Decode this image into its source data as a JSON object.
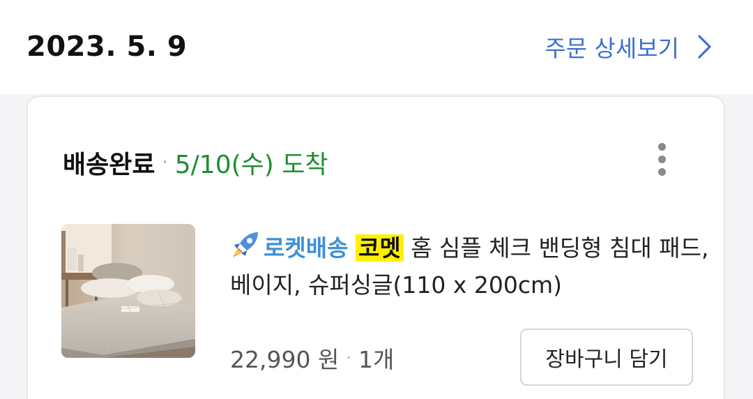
{
  "order": {
    "date": "2023. 5. 9",
    "detail_link_label": "주문 상세보기"
  },
  "shipment": {
    "status": "배송완료",
    "separator": "·",
    "arrival": "5/10(수) 도착"
  },
  "product": {
    "delivery_badge": "로켓배송",
    "brand": "코멧",
    "name_rest": " 홈 심플 체크 밴딩형 침대 패드, 베이지, 슈퍼싱글(110 x 200cm)",
    "price": "22,990 원",
    "separator": "·",
    "quantity": "1개",
    "add_to_cart_label": "장바구니 담기"
  },
  "colors": {
    "link_blue": "#3d6fd1",
    "arrival_green": "#1f8d32",
    "rocket_blue": "#3e8fd9",
    "brand_highlight": "#fff000"
  },
  "icons": {
    "detail_chevron": "chevron-right-icon",
    "more": "more-vertical-icon",
    "rocket": "rocket-icon"
  }
}
